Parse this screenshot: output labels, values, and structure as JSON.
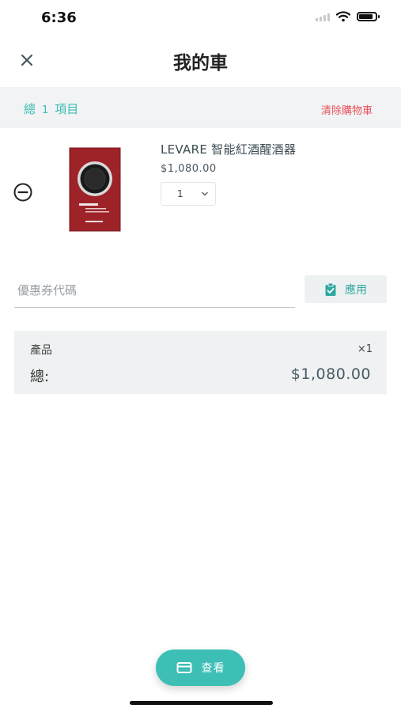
{
  "status_bar": {
    "time": "6:36",
    "battery_level": 0.85
  },
  "nav": {
    "title": "我的車",
    "close_icon": "close-icon"
  },
  "summary": {
    "total_label": "總",
    "item_count": "1",
    "items_label": "項目",
    "clear_cart": "清除購物車"
  },
  "cart": {
    "items": [
      {
        "name": "LEVARE 智能紅酒醒酒器",
        "price": "$1,080.00",
        "quantity": "1",
        "remove_icon": "minus-circle-icon"
      }
    ]
  },
  "coupon": {
    "placeholder": "優惠券代碼",
    "value": "",
    "apply_label": "應用",
    "apply_icon": "clipboard-check-icon"
  },
  "totals": {
    "product_label": "產品",
    "product_qty": "×1",
    "total_label": "總:",
    "total_amount": "$1,080.00"
  },
  "checkout": {
    "label": "查看",
    "icon": "card-icon"
  },
  "colors": {
    "accent": "#3dbfb6",
    "danger": "#e8505b",
    "panel": "#f1f3f4"
  }
}
